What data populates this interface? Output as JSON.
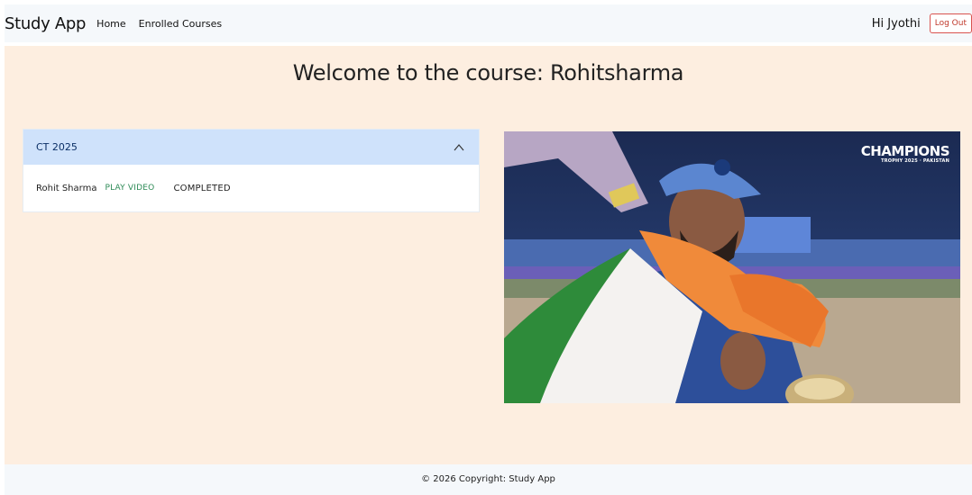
{
  "navbar": {
    "brand": "Study App",
    "links": [
      "Home",
      "Enrolled Courses"
    ],
    "greeting": "Hi Jyothi",
    "logout_label": "Log Out"
  },
  "main": {
    "title": "Welcome to the course: Rohitsharma",
    "accordion": {
      "title": "CT 2025",
      "expanded": true,
      "items": [
        {
          "name": "Rohit Sharma",
          "action": "PLAY VIDEO",
          "status": "COMPLETED"
        }
      ]
    },
    "media": {
      "badge_title": "CHAMPIONS",
      "badge_subtitle": "TROPHY 2025 · PAKISTAN"
    }
  },
  "footer": {
    "copyright": "© 2026 Copyright: Study App"
  },
  "colors": {
    "main_bg": "#fdeee0",
    "navbar_bg": "#f5f8fb",
    "accordion_header_bg": "#cfe2fb",
    "play_link": "#2e8b57",
    "logout": "#d9534f"
  }
}
